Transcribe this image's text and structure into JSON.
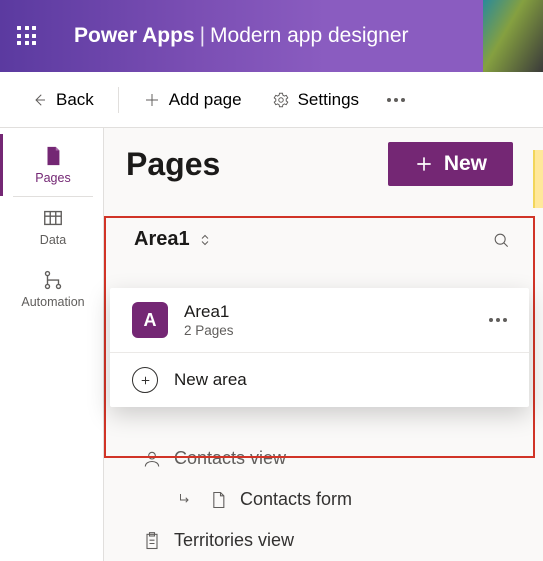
{
  "banner": {
    "app_name": "Power Apps",
    "page_sub": "Modern app designer"
  },
  "cmdbar": {
    "back": "Back",
    "add_page": "Add page",
    "settings": "Settings"
  },
  "leftnav": {
    "pages": "Pages",
    "data": "Data",
    "automation": "Automation"
  },
  "main": {
    "title": "Pages",
    "new_label": "New",
    "area_header": "Area1"
  },
  "dropdown": {
    "area_badge": "A",
    "area_title": "Area1",
    "area_sub": "2 Pages",
    "new_area": "New area"
  },
  "tree": {
    "contacts_view": "Contacts view",
    "contacts_form": "Contacts form",
    "territories_view": "Territories view"
  }
}
